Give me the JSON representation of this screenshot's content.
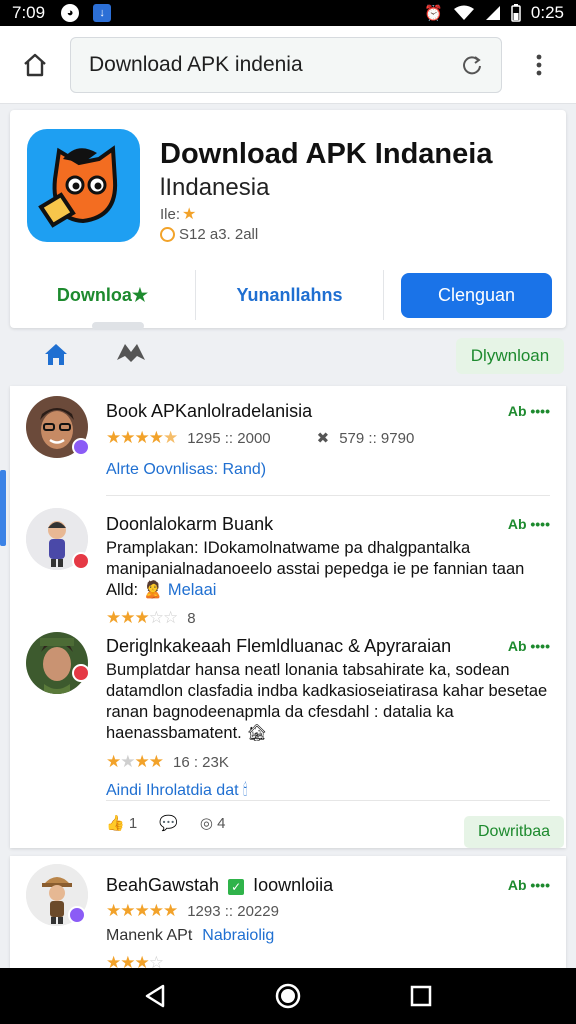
{
  "status": {
    "time": "7:09",
    "battery_time": "0:25"
  },
  "browser": {
    "url": "Download APK indenia"
  },
  "app": {
    "title": "Download APK Indaneia",
    "developer": "lIndanesia",
    "rating_text": "Ile:",
    "size_text": "S12 a3. 2all",
    "actions": {
      "download": "Downloa★",
      "secondary": "Yunanllahns",
      "primary": "Clenguan"
    }
  },
  "tabs": {
    "download_chip": "Dlywnloan"
  },
  "reviews": [
    {
      "name": "Book APKanlolradelanisia",
      "tag": "Ab ••••",
      "stars_filled": 4.5,
      "meta1": "1295 :: 2000",
      "meta2": "579 :: 9790",
      "link": "Alrte Oovnlisas: Rand)"
    },
    {
      "name": "Doonlalokarm Buank",
      "tag": "Ab ••••",
      "body": "Pramplakan: IDokamolnatwame pa dhalgpantalka manipanialnadanoeelo asstai pepedga ie pe fannian taan Alld:",
      "body_link": "Melaai",
      "stars_filled": 3,
      "count": "8"
    },
    {
      "name": "Deriglnkakeaah Flemldluanac & Apyraraian",
      "tag": "Ab ••••",
      "body": "Bumplatdar hansa neatl lonania tabsahirate ka, sodean datamdlon clasfadia indba kadkasioseiatirasa kahar besetae ranan bagnodeenapmla da cfesdahl : datalia ka haenassbamatent.",
      "stars_filled": 3.5,
      "meta1": "16 : 23K",
      "link": "Aindi Ihrolatdia dat"
    },
    {
      "name": "BeahGawstah",
      "name_suffix": "Ioownloiia",
      "tag": "Ab ••••",
      "stars_filled": 5,
      "meta1": "1293 :: 20229",
      "sub": "Manenk APt",
      "sub_link": "Nabraiolig"
    }
  ],
  "review_actions": {
    "likes": "1",
    "views": "4",
    "download_chip": "Dowritbaa"
  },
  "colors": {
    "accent_blue": "#1a73e8",
    "green": "#1d8a2e",
    "star": "#f2a22a"
  }
}
